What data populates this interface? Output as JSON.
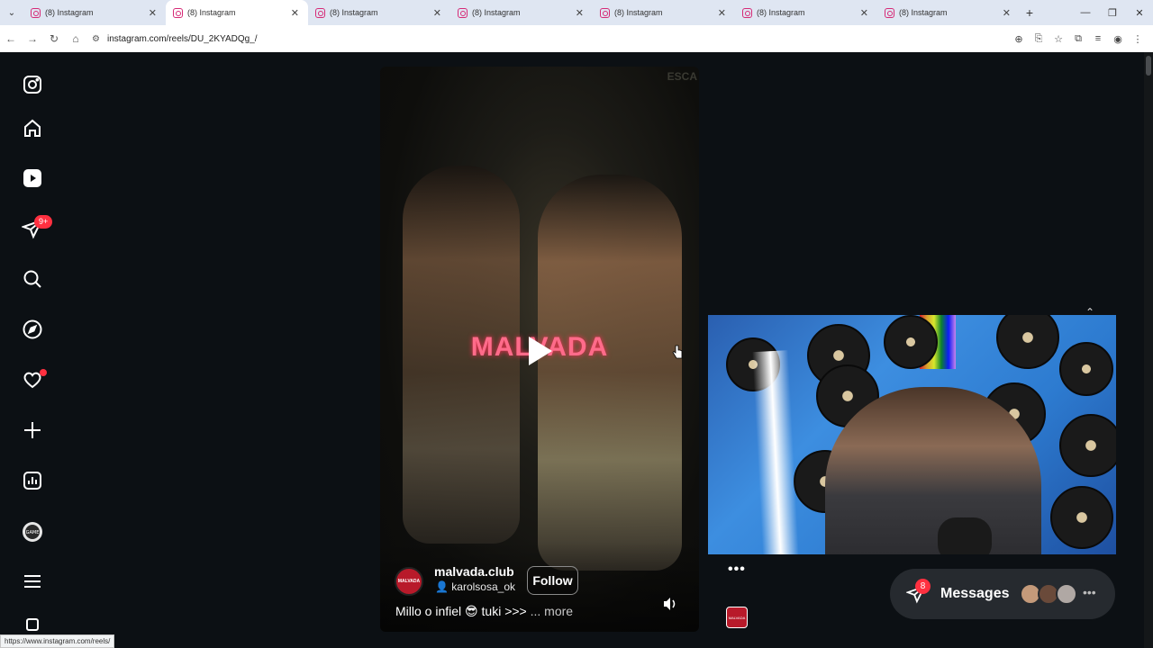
{
  "browser": {
    "tabs": [
      {
        "title": "(8) Instagram",
        "active": false
      },
      {
        "title": "(8) Instagram",
        "active": true
      },
      {
        "title": "(8) Instagram",
        "active": false
      },
      {
        "title": "(8) Instagram",
        "active": false
      },
      {
        "title": "(8) Instagram",
        "active": false
      },
      {
        "title": "(8) Instagram",
        "active": false
      },
      {
        "title": "(8) Instagram",
        "active": false
      }
    ],
    "url": "instagram.com/reels/DU_2KYADQg_/",
    "status_url": "https://www.instagram.com/reels/"
  },
  "sidebar": {
    "items": [
      {
        "name": "instagram-logo-icon"
      },
      {
        "name": "home-icon"
      },
      {
        "name": "reels-icon"
      },
      {
        "name": "direct-messages-icon",
        "badge": "9+"
      },
      {
        "name": "search-icon"
      },
      {
        "name": "explore-icon"
      },
      {
        "name": "notifications-icon",
        "dot": true
      },
      {
        "name": "create-icon"
      },
      {
        "name": "dashboard-icon"
      },
      {
        "name": "profile-avatar"
      },
      {
        "name": "more-menu-icon"
      }
    ]
  },
  "reel": {
    "overlay_text": "MALVADA",
    "watermark": "ESCA",
    "account_name": "malvada.club",
    "collab_name": "karolsosa_ok",
    "follow_label": "Follow",
    "caption": "Millo o infiel 😎 tuki >>>",
    "more_label": "... more"
  },
  "side_panel": {
    "options_label": "•••"
  },
  "messages": {
    "label": "Messages",
    "badge": "8",
    "more_label": "•••"
  },
  "colors": {
    "background": "#0c1014",
    "badge": "#ff3040",
    "messages_pill": "#262a2f"
  }
}
